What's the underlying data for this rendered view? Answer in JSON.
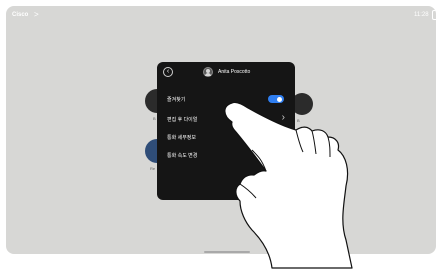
{
  "topbar": {
    "brand": "Cisco",
    "brand_chevron": ">",
    "time": "11:28",
    "status_icon_text": "N"
  },
  "background": {
    "labels": [
      "B",
      "B",
      "Re"
    ]
  },
  "panel": {
    "contact_name": "Anita Poscotto",
    "items": [
      {
        "label": "즐겨찾기",
        "control": "toggle",
        "toggle_on": true
      },
      {
        "label": "편집 후 다이얼",
        "control": "chevron"
      },
      {
        "label": "통화 세부정보",
        "control": "chevron"
      },
      {
        "label": "통화 속도 변경",
        "control": "none"
      }
    ]
  },
  "colors": {
    "screen_bg": "#d7d7d5",
    "panel_bg": "#151515",
    "toggle_on": "#2f7ef0",
    "text_light": "#ffffff"
  },
  "icons": {
    "back": "chevron-left-icon",
    "avatar": "person-avatar-icon",
    "chevron": "chevron-right-icon",
    "hand": "pointing-hand-illustration"
  }
}
